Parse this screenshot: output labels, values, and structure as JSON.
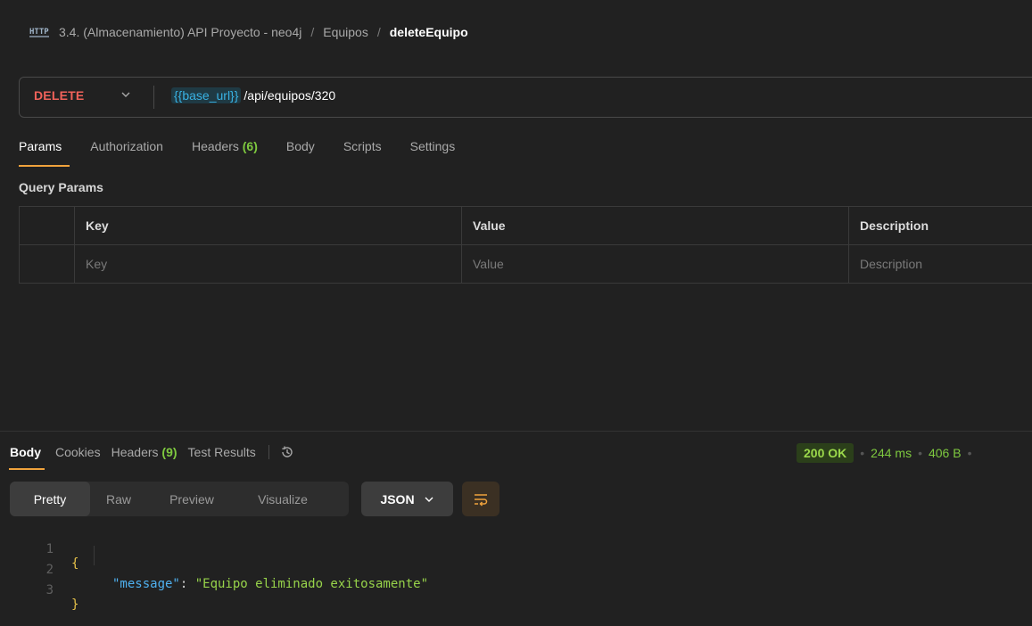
{
  "breadcrumb": {
    "icon": "http-icon",
    "collection": "3.4. (Almacenamiento) API Proyecto - neo4j",
    "folder": "Equipos",
    "separator": "/",
    "current": "deleteEquipo"
  },
  "request": {
    "method": "DELETE",
    "url_variable": "{{base_url}}",
    "url_path": "/api/equipos/320",
    "colors": {
      "method": "#f0625a",
      "variable": "#39b2e4"
    }
  },
  "request_tabs": [
    {
      "label": "Params",
      "count": "",
      "active": true
    },
    {
      "label": "Authorization",
      "count": "",
      "active": false
    },
    {
      "label": "Headers",
      "count": "(6)",
      "active": false
    },
    {
      "label": "Body",
      "count": "",
      "active": false
    },
    {
      "label": "Scripts",
      "count": "",
      "active": false
    },
    {
      "label": "Settings",
      "count": "",
      "active": false
    }
  ],
  "query_params": {
    "title": "Query Params",
    "columns": [
      "Key",
      "Value",
      "Description"
    ],
    "placeholders": [
      "Key",
      "Value",
      "Description"
    ]
  },
  "response": {
    "tabs": [
      {
        "label": "Body",
        "count": "",
        "active": true
      },
      {
        "label": "Cookies",
        "count": "",
        "active": false
      },
      {
        "label": "Headers",
        "count": "(9)",
        "active": false
      },
      {
        "label": "Test Results",
        "count": "",
        "active": false
      }
    ],
    "status": "200 OK",
    "time": "244 ms",
    "size": "406 B",
    "view_modes": [
      "Pretty",
      "Raw",
      "Preview",
      "Visualize"
    ],
    "active_view": "Pretty",
    "format": "JSON",
    "colors": {
      "status_ok": "#9bd84b",
      "accent": "#f0a33c"
    }
  },
  "code": {
    "line_numbers": [
      "1",
      "2",
      "3"
    ],
    "open_brace": "{",
    "close_brace": "}",
    "key": "\"message\"",
    "colon": ": ",
    "value": "\"Equipo eliminado exitosamente\""
  }
}
